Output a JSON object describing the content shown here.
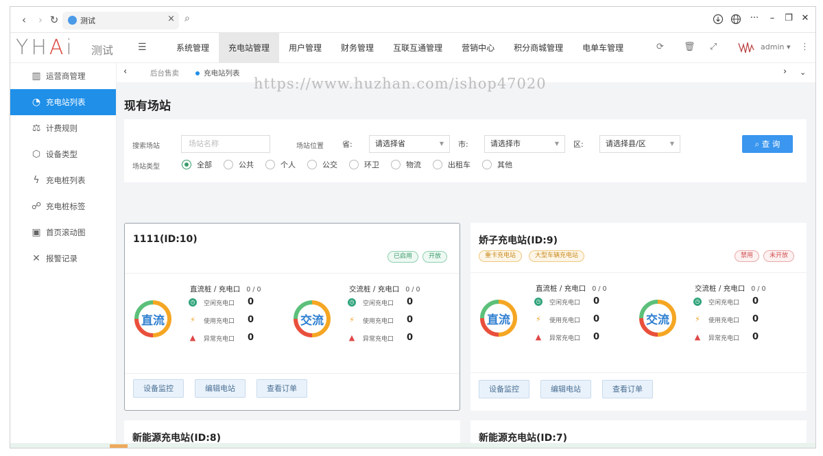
{
  "browser": {
    "tab_title": "测试",
    "tab_close": "×",
    "back": "‹",
    "forward": "›",
    "reload": "↻",
    "search": "⌕"
  },
  "header": {
    "logo_text": "测试",
    "nav": [
      "系统管理",
      "充电站管理",
      "用户管理",
      "财务管理",
      "互联互通管理",
      "营销中心",
      "积分商城管理",
      "电单车管理"
    ],
    "active_nav": "充电站管理",
    "user": "admin"
  },
  "sidebar": {
    "items": [
      {
        "label": "运营商管理",
        "icon": "building-icon"
      },
      {
        "label": "充电站列表",
        "icon": "pie-chart-icon",
        "active": true
      },
      {
        "label": "计费规则",
        "icon": "scale-icon"
      },
      {
        "label": "设备类型",
        "icon": "cube-icon"
      },
      {
        "label": "充电桩列表",
        "icon": "bolt-icon"
      },
      {
        "label": "充电桩标签",
        "icon": "tag-icon"
      },
      {
        "label": "首页滚动图",
        "icon": "image-icon"
      },
      {
        "label": "报警记录",
        "icon": "bell-off-icon"
      }
    ]
  },
  "breadcrumb": {
    "items": [
      "后台售卖",
      "充电站列表"
    ]
  },
  "watermark": "https://www.huzhan.com/ishop47020",
  "page_title": "现有场站",
  "filter": {
    "search_label": "搜索场站",
    "search_placeholder": "场站名称",
    "location_label": "场站位置",
    "province_label": "省:",
    "province_value": "请选择省",
    "city_label": "市:",
    "city_value": "请选择市",
    "district_label": "区:",
    "district_value": "请选择县/区",
    "query_button": "查 询",
    "type_label": "场站类型",
    "types": [
      "全部",
      "公共",
      "个人",
      "公交",
      "环卫",
      "物流",
      "出租车",
      "其他"
    ],
    "selected_type": "全部"
  },
  "labels": {
    "dc_head": "直流桩 / 充电口",
    "ac_head": "交流桩 / 充电口",
    "dc_ring": "直流",
    "ac_ring": "交流",
    "idle": "空闲充电口",
    "in_use": "使用充电口",
    "abnormal": "异常充电口",
    "btn_monitor": "设备监控",
    "btn_edit": "编辑电站",
    "btn_orders": "查看订单"
  },
  "stations": [
    {
      "name": "1111(ID:10)",
      "status_tags": [
        "已启用",
        "开放"
      ],
      "type_tags": [],
      "dc": {
        "count": "0 / 0",
        "idle": "0",
        "in_use": "0",
        "abnormal": "0"
      },
      "ac": {
        "count": "0 / 0",
        "idle": "0",
        "in_use": "0",
        "abnormal": "0"
      }
    },
    {
      "name": "娇子充电站(ID:9)",
      "status_tags": [
        "禁用",
        "未开放"
      ],
      "type_tags": [
        "重卡充电站",
        "大型车辆充电站"
      ],
      "dc": {
        "count": "0 / 0",
        "idle": "0",
        "in_use": "0",
        "abnormal": "0"
      },
      "ac": {
        "count": "0 / 0",
        "idle": "0",
        "in_use": "0",
        "abnormal": "0"
      }
    },
    {
      "name": "新能源充电站(ID:8)"
    },
    {
      "name": "新能源充电站(ID:7)"
    }
  ]
}
